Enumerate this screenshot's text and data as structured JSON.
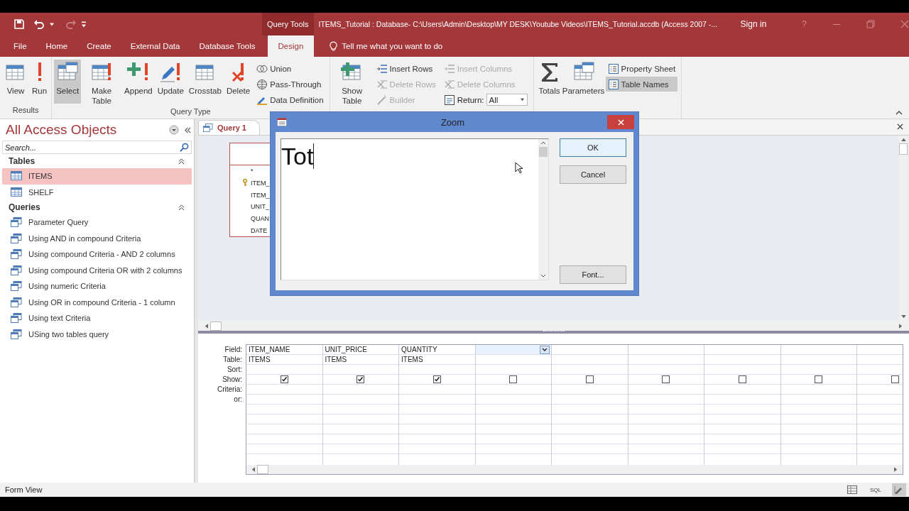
{
  "title_bar": {
    "context_label": "Query Tools",
    "title": "ITEMS_Tutorial : Database- C:\\Users\\Admin\\Desktop\\MY DESK\\Youtube Videos\\ITEMS_Tutorial.accdb (Access 2007 -...",
    "sign_in": "Sign in",
    "help": "?"
  },
  "tabs": [
    {
      "label": "File",
      "selected": false
    },
    {
      "label": "Home",
      "selected": false
    },
    {
      "label": "Create",
      "selected": false
    },
    {
      "label": "External Data",
      "selected": false
    },
    {
      "label": "Database Tools",
      "selected": false
    },
    {
      "label": "Design",
      "selected": true
    }
  ],
  "tell_me": {
    "placeholder": "Tell me what you want to do"
  },
  "ribbon": {
    "groups": [
      {
        "label": "Results",
        "items": [
          {
            "kind": "large",
            "label": "View",
            "selected": false
          },
          {
            "kind": "large",
            "label": "Run",
            "selected": false
          }
        ]
      },
      {
        "label": "Query Type",
        "items": [
          {
            "kind": "large",
            "label": "Select",
            "selected": true
          },
          {
            "kind": "large",
            "label": "Make Table",
            "selected": false
          },
          {
            "kind": "large",
            "label": "Append",
            "selected": false
          },
          {
            "kind": "large",
            "label": "Update",
            "selected": false
          },
          {
            "kind": "large",
            "label": "Crosstab",
            "selected": false
          },
          {
            "kind": "large",
            "label": "Delete",
            "selected": false
          },
          {
            "kind": "stack",
            "rows": [
              {
                "kind": "button",
                "label": "Union",
                "disabled": false,
                "selected": false
              },
              {
                "kind": "button",
                "label": "Pass-Through",
                "disabled": false,
                "selected": false
              },
              {
                "kind": "button",
                "label": "Data Definition",
                "disabled": false,
                "selected": false
              }
            ]
          }
        ]
      },
      {
        "items": [
          {
            "kind": "large",
            "label": "Show Table",
            "selected": false
          },
          {
            "kind": "stack",
            "rows": [
              {
                "kind": "button",
                "label": "Insert Rows",
                "disabled": false,
                "selected": false
              },
              {
                "kind": "button",
                "label": "Delete Rows",
                "disabled": true,
                "selected": false
              },
              {
                "kind": "button",
                "label": "Builder",
                "disabled": true,
                "selected": false
              }
            ]
          },
          {
            "kind": "stack",
            "rows": [
              {
                "kind": "button",
                "label": "Insert Columns",
                "disabled": true,
                "selected": false
              },
              {
                "kind": "button",
                "label": "Delete Columns",
                "disabled": true,
                "selected": false
              },
              {
                "kind": "combo",
                "label": "Return:",
                "value": "All"
              }
            ]
          }
        ]
      },
      {
        "items": [
          {
            "kind": "large",
            "label": "Totals",
            "selected": false
          },
          {
            "kind": "large",
            "label": "Parameters",
            "selected": false
          },
          {
            "kind": "stack",
            "rows": [
              {
                "kind": "button",
                "label": "Property Sheet",
                "disabled": false,
                "selected": false
              },
              {
                "kind": "button",
                "label": "Table Names",
                "disabled": false,
                "selected": true
              }
            ]
          }
        ]
      }
    ]
  },
  "navigation": {
    "title": "All Access Objects",
    "search": {
      "placeholder": "Search..."
    },
    "sections": [
      {
        "kind": "tables",
        "label": "Tables",
        "items": [
          {
            "label": "ITEMS",
            "selected": true
          },
          {
            "label": "SHELF",
            "selected": false
          }
        ]
      },
      {
        "kind": "queries",
        "label": "Queries",
        "items": [
          {
            "label": "Parameter Query",
            "selected": false
          },
          {
            "label": "Using AND in compound Criteria",
            "selected": false
          },
          {
            "label": "Using compound Criteria - AND 2 columns",
            "selected": false
          },
          {
            "label": "Using compound Criteria OR with 2 columns",
            "selected": false
          },
          {
            "label": "Using numeric Criteria",
            "selected": false
          },
          {
            "label": "Using OR in compound Criteria - 1 column",
            "selected": false
          },
          {
            "label": "Using text Criteria",
            "selected": false
          },
          {
            "label": "USing two tables query",
            "selected": false
          }
        ]
      }
    ]
  },
  "document_tab": {
    "label": "Query 1"
  },
  "table_box": {
    "fields": [
      {
        "label": "*",
        "key": false
      },
      {
        "label": "ITEM_",
        "key": true
      },
      {
        "label": "ITEM_",
        "key": false
      },
      {
        "label": "UNIT_",
        "key": false
      },
      {
        "label": "QUAN",
        "key": false
      },
      {
        "label": "DATE",
        "key": false
      }
    ]
  },
  "zoom_dialog": {
    "title": "Zoom",
    "text": "Tot",
    "buttons": [
      {
        "label": "OK",
        "default": true
      },
      {
        "label": "Cancel",
        "default": false
      },
      {
        "label": "Font...",
        "default": false
      }
    ]
  },
  "grid": {
    "row_labels": [
      "Field:",
      "Table:",
      "Sort:",
      "Show:",
      "Criteria:",
      "or:"
    ],
    "columns": [
      {
        "field": "ITEM_NAME",
        "table": "ITEMS",
        "show": true,
        "dropdown": false
      },
      {
        "field": "UNIT_PRICE",
        "table": "ITEMS",
        "show": true,
        "dropdown": false
      },
      {
        "field": "QUANTITY",
        "table": "ITEMS",
        "show": true,
        "dropdown": false
      },
      {
        "show": false,
        "dropdown": true
      },
      {
        "show": false,
        "dropdown": false
      },
      {
        "show": false,
        "dropdown": false
      },
      {
        "show": false,
        "dropdown": false
      },
      {
        "show": false,
        "dropdown": false
      },
      {
        "show": false,
        "dropdown": false
      }
    ]
  },
  "status_bar": {
    "text": "Form View",
    "views": [
      {
        "kind": "datasheet",
        "selected": false
      },
      {
        "kind": "sql",
        "label": "SQL",
        "selected": false
      },
      {
        "kind": "design",
        "selected": true
      }
    ]
  }
}
